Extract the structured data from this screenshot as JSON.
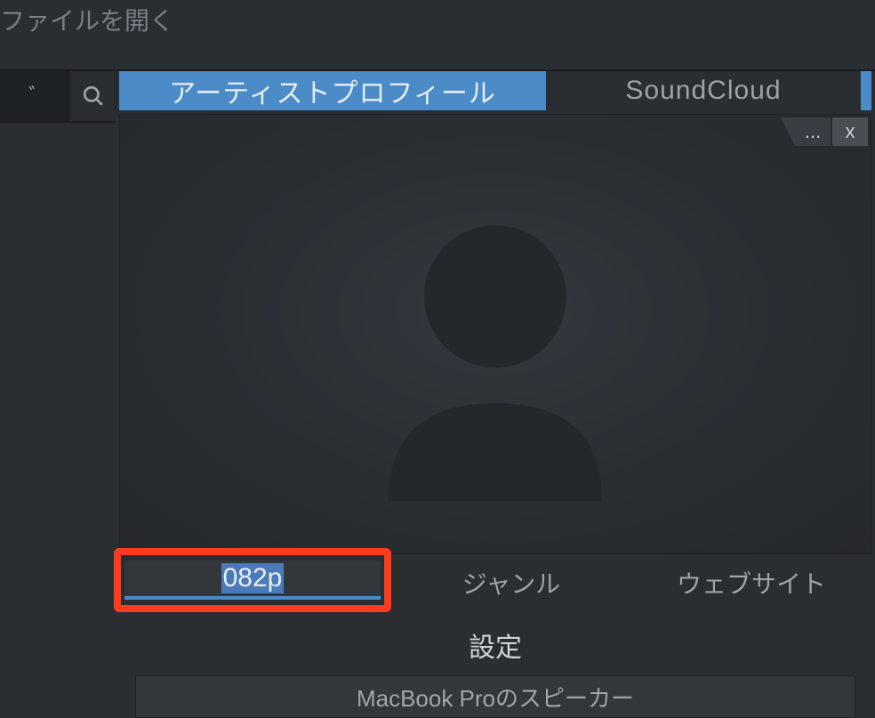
{
  "topbar": {
    "open_file": "ファイルを開く"
  },
  "left": {
    "tab_glyph": "゙"
  },
  "tabs": {
    "active": "アーティストプロフィール",
    "second": "SoundCloud"
  },
  "corner": {
    "more": "...",
    "close": "x"
  },
  "fields": {
    "input_value": "082p",
    "genre": "ジャンル",
    "website": "ウェブサイト"
  },
  "settings": {
    "title": "設定",
    "speaker": "MacBook Proのスピーカー"
  }
}
